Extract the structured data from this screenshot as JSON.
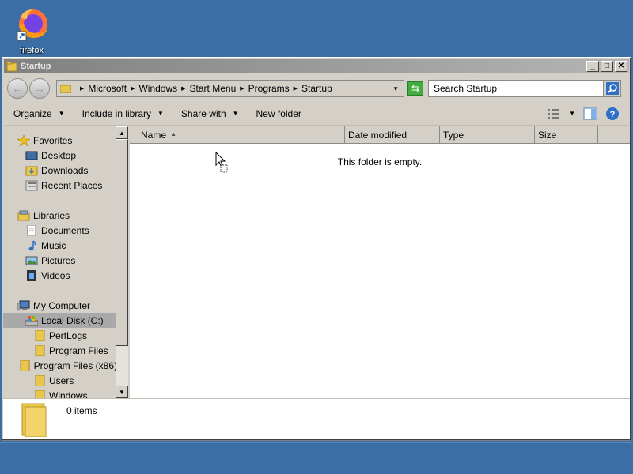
{
  "desktop": {
    "icons": [
      {
        "label": "firefox",
        "icon": "firefox-icon"
      }
    ]
  },
  "window": {
    "title": "Startup",
    "controls": {
      "minimize": "_",
      "maximize": "□",
      "close": "✕"
    }
  },
  "address": {
    "crumbs": [
      "Microsoft",
      "Windows",
      "Start Menu",
      "Programs",
      "Startup"
    ],
    "search_placeholder": "Search Startup"
  },
  "toolbar": {
    "organize": "Organize",
    "include_in_library": "Include in library",
    "share_with": "Share with",
    "new_folder": "New folder"
  },
  "nav": {
    "items": [
      {
        "label": "Favorites",
        "icon": "star-icon",
        "indent": 0
      },
      {
        "label": "Desktop",
        "icon": "desktop-icon",
        "indent": 1
      },
      {
        "label": "Downloads",
        "icon": "downloads-folder-icon",
        "indent": 1
      },
      {
        "label": "Recent Places",
        "icon": "recent-places-icon",
        "indent": 1
      },
      {
        "label": "Libraries",
        "icon": "libraries-icon",
        "indent": 0
      },
      {
        "label": "Documents",
        "icon": "documents-icon",
        "indent": 1
      },
      {
        "label": "Music",
        "icon": "music-icon",
        "indent": 1
      },
      {
        "label": "Pictures",
        "icon": "pictures-icon",
        "indent": 1
      },
      {
        "label": "Videos",
        "icon": "videos-icon",
        "indent": 1
      },
      {
        "label": "My Computer",
        "icon": "computer-icon",
        "indent": 0
      },
      {
        "label": "Local Disk (C:)",
        "icon": "drive-icon",
        "indent": 1,
        "selected": true
      },
      {
        "label": "PerfLogs",
        "icon": "folder-icon",
        "indent": 2
      },
      {
        "label": "Program Files",
        "icon": "folder-icon",
        "indent": 2
      },
      {
        "label": "Program Files (x86)",
        "icon": "folder-icon",
        "indent": 2
      },
      {
        "label": "Users",
        "icon": "folder-icon",
        "indent": 2
      },
      {
        "label": "Windows",
        "icon": "folder-icon",
        "indent": 2
      }
    ]
  },
  "columns": [
    "Name",
    "Date modified",
    "Type",
    "Size"
  ],
  "content": {
    "empty_message": "This folder is empty."
  },
  "details": {
    "item_count": "0 items"
  }
}
